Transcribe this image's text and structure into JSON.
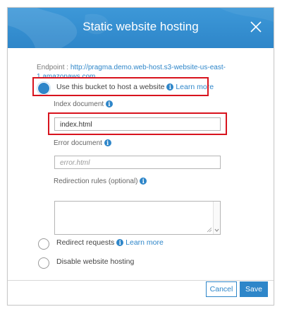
{
  "dialog": {
    "title": "Static website hosting",
    "endpoint_label": "Endpoint :",
    "endpoint_url": "http://pragma.demo.web-host.s3-website-us-east-1.amazonaws.com"
  },
  "options": {
    "host": {
      "label": "Use this bucket to host a website",
      "learn_more": "Learn more",
      "selected": true
    },
    "redirect": {
      "label": "Redirect requests",
      "learn_more": "Learn more",
      "selected": false
    },
    "disable": {
      "label": "Disable website hosting",
      "selected": false
    }
  },
  "fields": {
    "index_document": {
      "label": "Index document",
      "value": "index.html"
    },
    "error_document": {
      "label": "Error document",
      "placeholder": "error.html"
    },
    "redirection_rules": {
      "label": "Redirection rules (optional)"
    }
  },
  "buttons": {
    "cancel": "Cancel",
    "save": "Save"
  },
  "colors": {
    "accent": "#2e86c9",
    "highlight": "#d8141e"
  }
}
